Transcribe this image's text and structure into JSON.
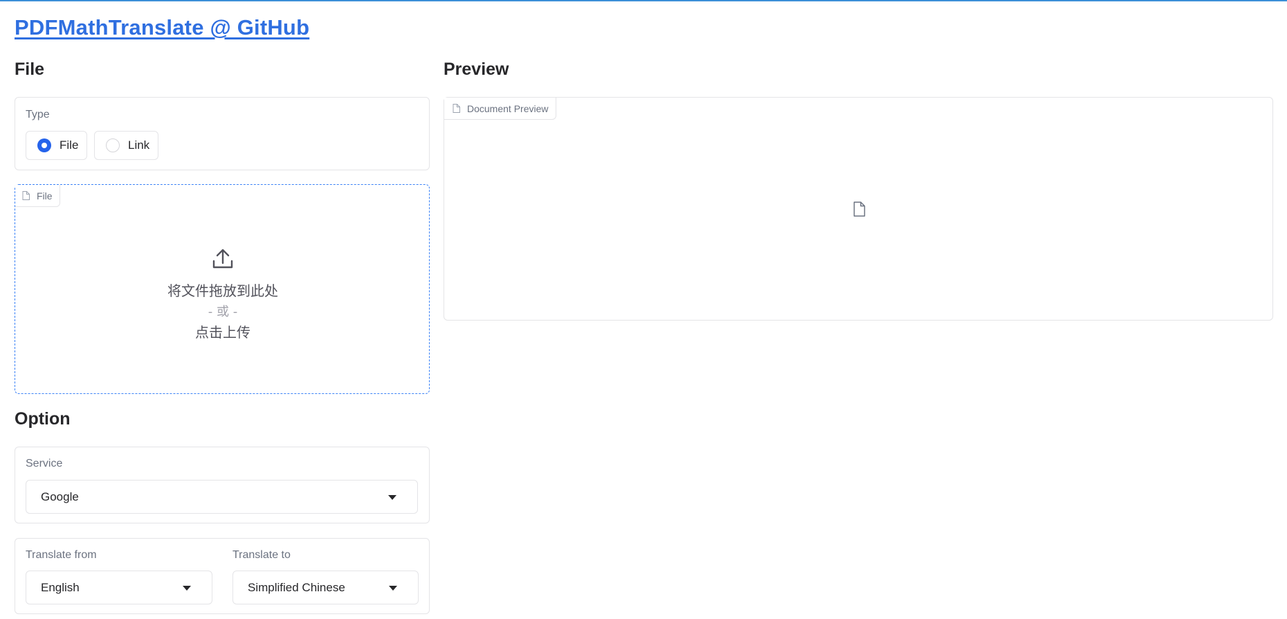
{
  "header": {
    "title": "PDFMathTranslate @ GitHub"
  },
  "file_section": {
    "title": "File",
    "type_label": "Type",
    "radio_options": [
      {
        "label": "File",
        "checked": true
      },
      {
        "label": "Link",
        "checked": false
      }
    ],
    "upload": {
      "tag": "File",
      "drop_text": "将文件拖放到此处",
      "or_text": "- 或 -",
      "click_text": "点击上传"
    }
  },
  "preview_section": {
    "title": "Preview",
    "tag": "Document Preview"
  },
  "option_section": {
    "title": "Option",
    "service_label": "Service",
    "service_value": "Google",
    "from_label": "Translate from",
    "from_value": "English",
    "to_label": "Translate to",
    "to_value": "Simplified Chinese"
  },
  "colors": {
    "accent": "#2563eb",
    "link": "#2f6fe0",
    "topbar": "#3b8fd8",
    "dropzone_border": "#3b82f6"
  },
  "icons": [
    "file-icon",
    "upload-icon",
    "chevron-down-icon"
  ]
}
